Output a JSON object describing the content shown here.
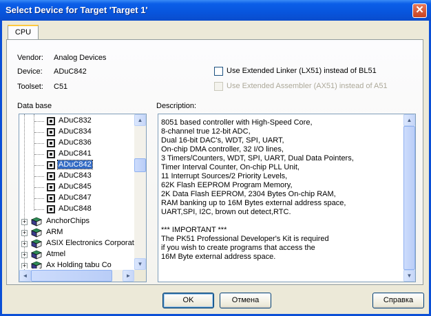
{
  "window": {
    "title": "Select Device for Target 'Target 1'",
    "close_glyph": "✕"
  },
  "tabs": [
    {
      "label": "CPU"
    }
  ],
  "info": {
    "vendor_label": "Vendor:",
    "vendor_value": "Analog Devices",
    "device_label": "Device:",
    "device_value": "ADuC842",
    "toolset_label": "Toolset:",
    "toolset_value": "C51"
  },
  "options": {
    "linker_label": "Use Extended Linker (LX51) instead of BL51",
    "linker_checked": false,
    "assembler_label": "Use Extended Assembler (AX51) instead of A51",
    "assembler_checked": false,
    "assembler_enabled": false
  },
  "database": {
    "label": "Data base",
    "devices": [
      "ADuC832",
      "ADuC834",
      "ADuC836",
      "ADuC841",
      "ADuC842",
      "ADuC843",
      "ADuC845",
      "ADuC847",
      "ADuC848"
    ],
    "selected": "ADuC842",
    "vendors": [
      "AnchorChips",
      "ARM",
      "ASIX Electronics Corporat",
      "Atmel",
      "Ax Holding tabu Co"
    ]
  },
  "description": {
    "label": "Description:",
    "lines": [
      "8051 based controller with High-Speed Core,",
      "8-channel true 12-bit ADC,",
      "Dual 16-bit DAC's, WDT, SPI, UART,",
      "On-chip DMA controller, 32 I/O lines,",
      "3 Timers/Counters, WDT, SPI, UART, Dual Data Pointers,",
      "Timer Interval Counter, On-chip PLL Unit,",
      "11 Interrupt Sources/2 Priority Levels,",
      "62K Flash EEPROM Program Memory,",
      "2K Data Flash EEPROM, 2304 Bytes On-chip RAM,",
      "RAM banking up to 16M Bytes external address space,",
      "UART,SPI, I2C, brown out detect,RTC.",
      "",
      "*** IMPORTANT ***",
      "The PK51 Professional Developer's Kit is required",
      "if you wish to create programs that access the",
      "16M Byte external address space."
    ]
  },
  "buttons": {
    "ok": "OK",
    "cancel": "Отмена",
    "help": "Справка"
  },
  "icons": {
    "scroll_up": "▲",
    "scroll_down": "▼",
    "scroll_left": "◄",
    "scroll_right": "►",
    "plus": "+"
  },
  "colors": {
    "title_bar": "#0855dd",
    "selection": "#316ac5",
    "dialog_bg": "#ece9d8"
  }
}
